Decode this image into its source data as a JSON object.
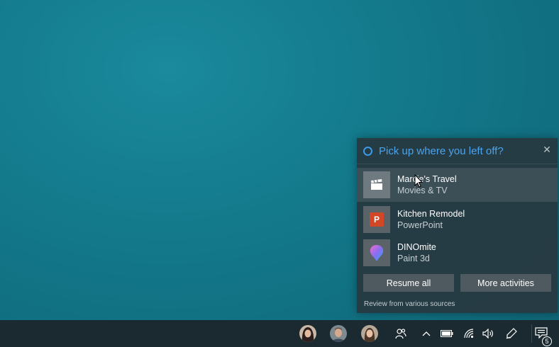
{
  "flyout": {
    "title": "Pick up where you left off?",
    "close_icon": "close-icon",
    "activities": [
      {
        "name": "Marcie's Travel",
        "app": "Movies & TV",
        "icon": "clapperboard-icon"
      },
      {
        "name": "Kitchen Remodel",
        "app": "PowerPoint",
        "icon": "powerpoint-icon",
        "badge": "P"
      },
      {
        "name": "DINOmite",
        "app": "Paint 3d",
        "icon": "paint3d-icon"
      }
    ],
    "resume_all_label": "Resume all",
    "more_activities_label": "More activities",
    "review_text": "Review from various sources",
    "accent_color": "#4aa3ee"
  },
  "taskbar": {
    "notification_count": "5",
    "tray_icons": [
      "avatar-1",
      "avatar-2",
      "avatar-3",
      "people-icon",
      "chevron-up-icon",
      "battery-icon",
      "wifi-icon",
      "volume-icon",
      "pen-icon",
      "action-center-icon"
    ]
  }
}
